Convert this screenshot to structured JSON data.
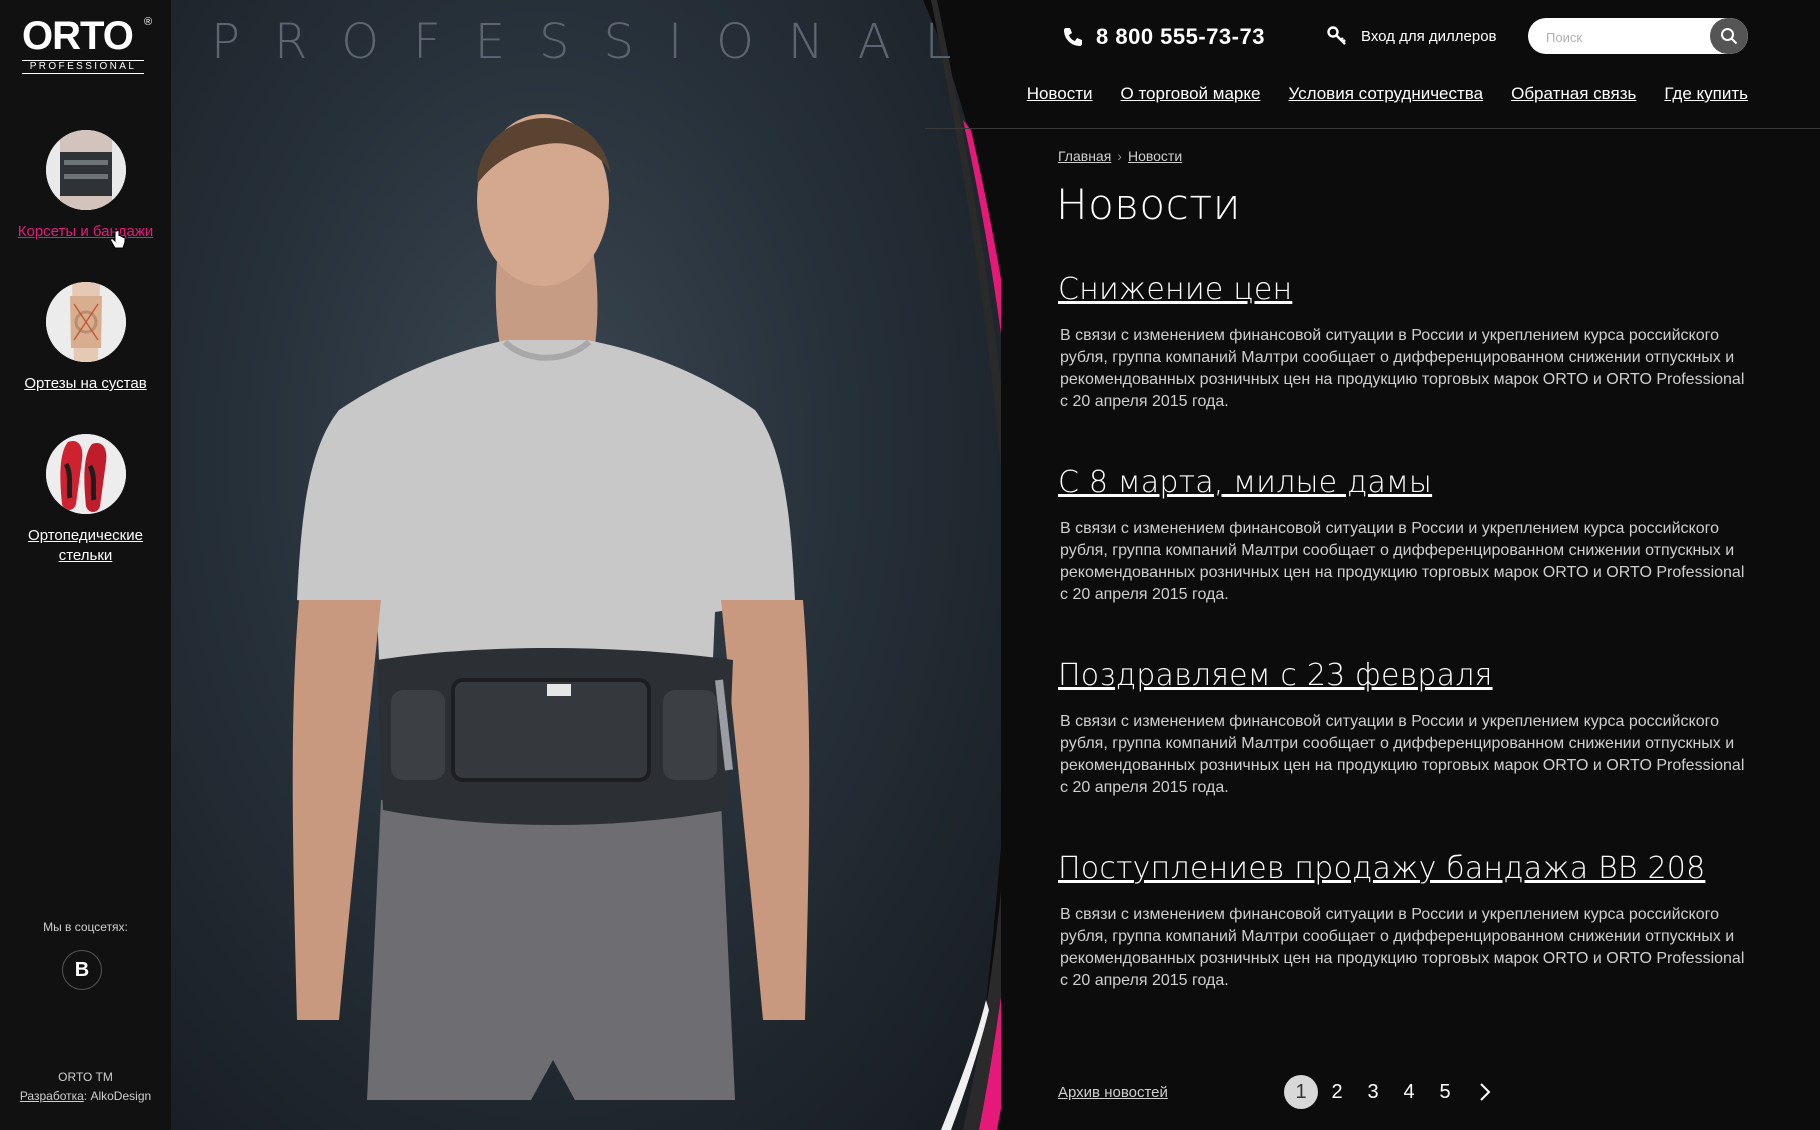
{
  "sidebar": {
    "logo": {
      "main": "ORTO",
      "sub": "PROFESSIONAL",
      "mark": "®"
    },
    "categories": [
      {
        "label": "Корсеты и бандажи",
        "icon": "corset-thumb",
        "active": true
      },
      {
        "label": "Ортезы на сустав",
        "icon": "knee-orthosis-thumb",
        "active": false
      },
      {
        "label": "Ортопедические стельки",
        "icon": "insoles-thumb",
        "active": false
      }
    ],
    "social": {
      "title": "Мы в соцсетях:",
      "vk": "B"
    },
    "footer": {
      "tm": "ORTO TM",
      "dev_link": "Разработка",
      "dev_name": ": AlkoDesign"
    }
  },
  "hero": {
    "word": "PROFESSIONAL"
  },
  "header": {
    "phone": "8 800 555-73-73",
    "dealer_login": "Вход для диллеров",
    "search_placeholder": "Поиск",
    "nav": [
      "Новости",
      "О торговой марке",
      "Условия сотрудничества",
      "Обратная связь",
      "Где купить"
    ]
  },
  "breadcrumbs": [
    "Главная",
    "Новости"
  ],
  "page_title": "Новости",
  "news": [
    {
      "title": "Снижение цен",
      "text": "В связи с изменением финансовой ситуации в России и укреплением курса российского рубля, группа компаний Малтри сообщает о дифференцированном снижении отпускных и рекомендованных розничных цен на продукцию торговых марок ORTO и ORTO Professional с 20 апреля 2015 года."
    },
    {
      "title": "С 8 марта, милые дамы",
      "text": "В связи с изменением финансовой ситуации в России и укреплением курса российского рубля, группа компаний Малтри сообщает о дифференцированном снижении отпускных и рекомендованных розничных цен на продукцию торговых марок ORTO и ORTO Professional с 20 апреля 2015 года."
    },
    {
      "title": "Поздравляем с 23 февраля",
      "text": "В связи с изменением финансовой ситуации в России и укреплением курса российского рубля, группа компаний Малтри сообщает о дифференцированном снижении отпускных и рекомендованных розничных цен на продукцию торговых марок ORTO и ORTO Professional с 20 апреля 2015 года."
    },
    {
      "title": "Поступлениев продажу бандажа BB 208",
      "text": "В связи с изменением финансовой ситуации в России и укреплением курса российского рубля, группа компаний Малтри сообщает о дифференцированном снижении отпускных и рекомендованных розничных цен на продукцию торговых марок ORTO и ORTO Professional с 20 апреля 2015 года."
    }
  ],
  "archive_link": "Архив новостей",
  "pagination": {
    "pages": [
      "1",
      "2",
      "3",
      "4",
      "5"
    ],
    "current": "1"
  },
  "colors": {
    "accent": "#e5197a",
    "background": "#0c0c0c",
    "sidebar": "#111111",
    "text_muted": "#cfcfcf"
  }
}
